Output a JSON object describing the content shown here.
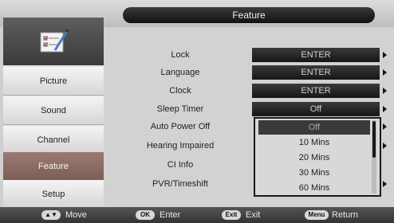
{
  "header": {
    "title": "Feature"
  },
  "sidebar": {
    "icon": "notepad-checklist-icon",
    "items": [
      {
        "label": "Picture",
        "active": false
      },
      {
        "label": "Sound",
        "active": false
      },
      {
        "label": "Channel",
        "active": false
      },
      {
        "label": "Feature",
        "active": true
      },
      {
        "label": "Setup",
        "active": false
      }
    ]
  },
  "settings": [
    {
      "label": "Lock",
      "value": "ENTER"
    },
    {
      "label": "Language",
      "value": "ENTER"
    },
    {
      "label": "Clock",
      "value": "ENTER"
    },
    {
      "label": "Sleep Timer",
      "value": "Off"
    },
    {
      "label": "Auto Power Off",
      "value": ""
    },
    {
      "label": "Hearing Impaired",
      "value": ""
    },
    {
      "label": "CI Info",
      "value": ""
    },
    {
      "label": "PVR/Timeshift",
      "value": ""
    }
  ],
  "dropdown": {
    "options": [
      "Off",
      "10 Mins",
      "20 Mins",
      "30 Mins",
      "60 Mins"
    ],
    "selected_index": 0
  },
  "footer": {
    "move": {
      "key": "▲▼",
      "label": "Move"
    },
    "enter": {
      "key": "OK",
      "label": "Enter"
    },
    "exit": {
      "key": "Exit",
      "label": "Exit"
    },
    "return": {
      "key": "Menu",
      "label": "Return"
    }
  },
  "colors": {
    "active_item": "#8a6b64",
    "pill": "#1e1e1e",
    "background": "#d2d2d2"
  }
}
